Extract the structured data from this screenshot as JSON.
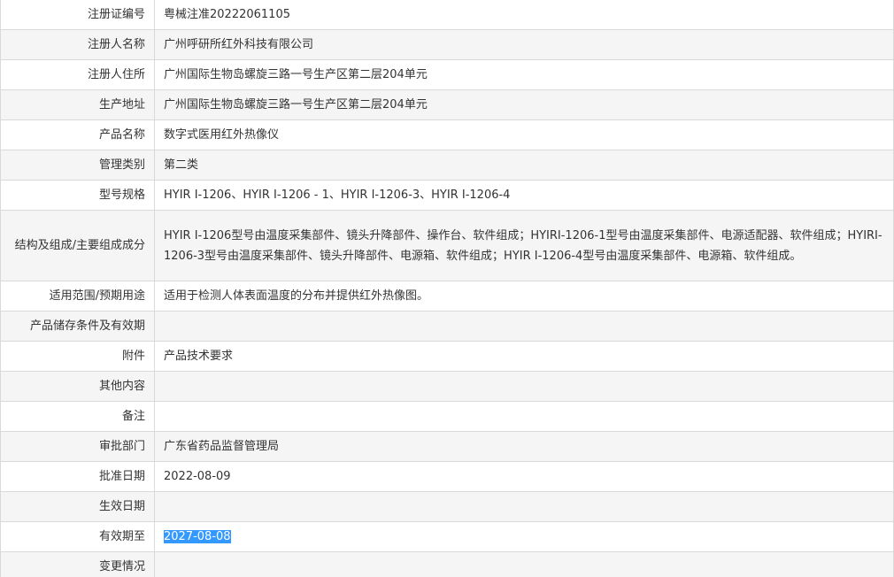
{
  "rows": [
    {
      "label": "注册证编号",
      "value": "粤械注准20222061105"
    },
    {
      "label": "注册人名称",
      "value": "广州呼研所红外科技有限公司"
    },
    {
      "label": "注册人住所",
      "value": "广州国际生物岛螺旋三路一号生产区第二层204单元"
    },
    {
      "label": "生产地址",
      "value": "广州国际生物岛螺旋三路一号生产区第二层204单元"
    },
    {
      "label": "产品名称",
      "value": "数字式医用红外热像仪"
    },
    {
      "label": "管理类别",
      "value": "第二类"
    },
    {
      "label": "型号规格",
      "value": "HYIR I-1206、HYIR I-1206 - 1、HYIR I-1206-3、HYIR I-1206-4"
    },
    {
      "label": "结构及组成/主要组成成分",
      "value": "HYIR I-1206型号由温度采集部件、镜头升降部件、操作台、软件组成；HYIRI-1206-1型号由温度采集部件、电源适配器、软件组成；HYIRI-1206-3型号由温度采集部件、镜头升降部件、电源箱、软件组成；HYIR I-1206-4型号由温度采集部件、电源箱、软件组成。"
    },
    {
      "label": "适用范围/预期用途",
      "value": "适用于检测人体表面温度的分布并提供红外热像图。"
    },
    {
      "label": "产品储存条件及有效期",
      "value": ""
    },
    {
      "label": "附件",
      "value": "产品技术要求"
    },
    {
      "label": "其他内容",
      "value": ""
    },
    {
      "label": "备注",
      "value": ""
    },
    {
      "label": "审批部门",
      "value": "广东省药品监督管理局"
    },
    {
      "label": "批准日期",
      "value": "2022-08-09"
    },
    {
      "label": "生效日期",
      "value": ""
    },
    {
      "label": "有效期至",
      "value": "2027-08-08"
    },
    {
      "label": "变更情况",
      "value": ""
    }
  ],
  "colors": {
    "border": "#d9d9d9",
    "row_alt": "#f5f5f5",
    "selection": "#3399ff"
  }
}
